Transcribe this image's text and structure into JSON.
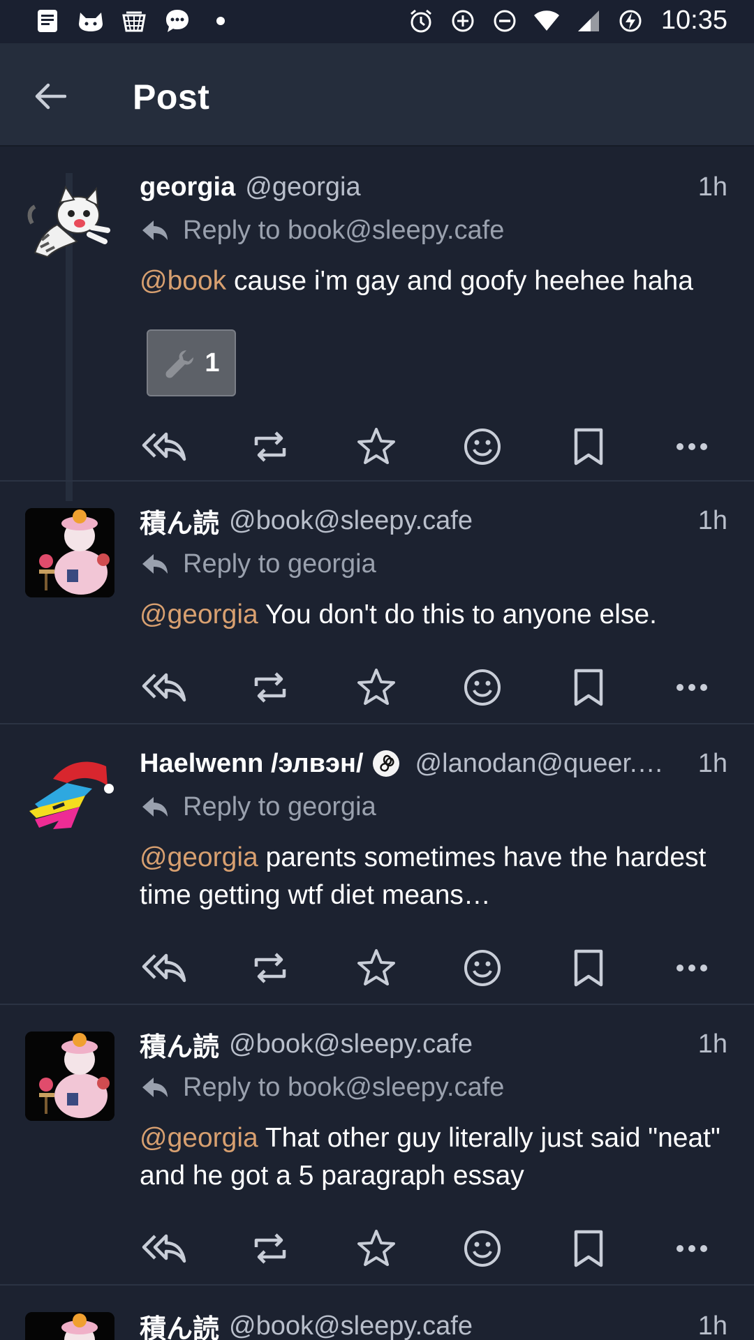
{
  "status_bar": {
    "time": "10:35",
    "left_icons": [
      "notes-icon",
      "cat-icon",
      "hamper-icon",
      "chat-bubble-icon",
      "dot-icon"
    ],
    "right_icons": [
      "alarm-icon",
      "data-saver-icon",
      "do-not-disturb-icon",
      "wifi-icon",
      "signal-icon",
      "battery-charging-icon"
    ]
  },
  "app_bar": {
    "back_icon": "arrow-back-icon",
    "title": "Post"
  },
  "colors": {
    "background": "#1c2230",
    "app_bar": "#252d3c",
    "mention": "#d8a070",
    "secondary_text": "#b9bfcb",
    "icon": "#c9ced8"
  },
  "actions": [
    "reply-all-icon",
    "repost-icon",
    "star-icon",
    "emoji-icon",
    "bookmark-icon",
    "more-icon"
  ],
  "posts": [
    {
      "display_name": "georgia",
      "handle": "@georgia",
      "time": "1h",
      "reply_to": "Reply to book@sleepy.cafe",
      "mention": "@book",
      "text": " cause i'm gay and goofy heehee haha",
      "reaction": {
        "icon": "wrench-icon",
        "count": "1"
      }
    },
    {
      "display_name": "積ん読",
      "handle": "@book@sleepy.cafe",
      "time": "1h",
      "reply_to": "Reply to georgia",
      "mention": "@georgia",
      "text": " You don't do this to anyone else."
    },
    {
      "display_name": "Haelwenn /элвэн/",
      "handle": "@lanodan@queer.…",
      "time": "1h",
      "reply_to": "Reply to georgia",
      "mention": "@georgia",
      "text": " parents sometimes have the hardest time getting wtf diet means…"
    },
    {
      "display_name": "積ん読",
      "handle": "@book@sleepy.cafe",
      "time": "1h",
      "reply_to": "Reply to book@sleepy.cafe",
      "mention": "@georgia",
      "text": " That other guy literally just said \"neat\" and he got a 5 paragraph essay"
    },
    {
      "display_name": "積ん読",
      "handle": "@book@sleepy.cafe",
      "time": "1h"
    }
  ]
}
